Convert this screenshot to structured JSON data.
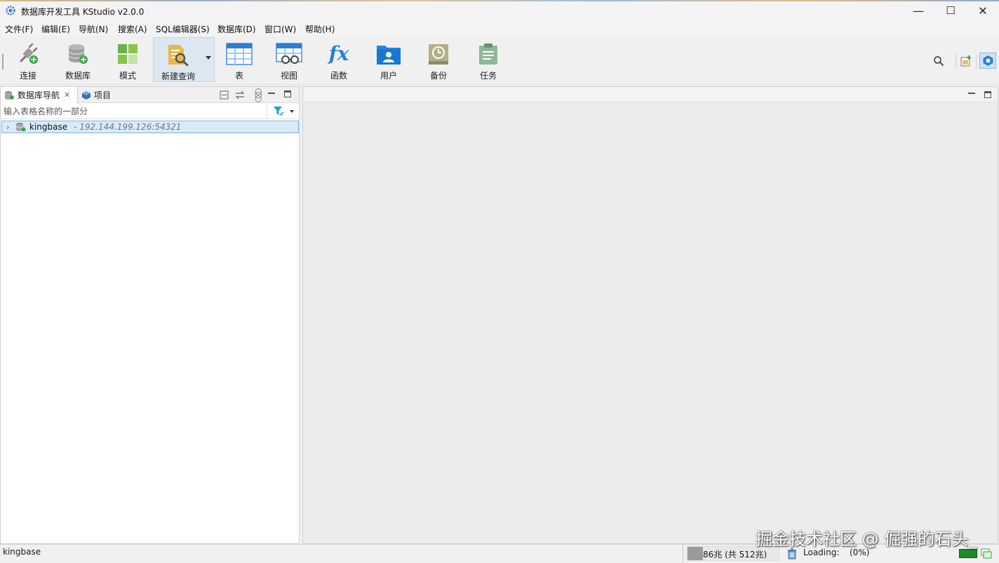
{
  "window": {
    "title": "数据库开发工具 KStudio v2.0.0",
    "minimize_glyph": "—",
    "maximize_glyph": "☐",
    "close_glyph": "✕"
  },
  "menu": [
    "文件(F)",
    "编辑(E)",
    "导航(N)",
    "搜索(A)",
    "SQL编辑器(S)",
    "数据库(D)",
    "窗口(W)",
    "帮助(H)"
  ],
  "toolbar": {
    "connect": "连接",
    "database": "数据库",
    "schema": "模式",
    "new_query": "新建查询",
    "table": "表",
    "view": "视图",
    "function": "函数",
    "function_glyph": "fx",
    "user": "用户",
    "backup": "备份",
    "task": "任务"
  },
  "navigator": {
    "tab_db_nav": "数据库导航",
    "tab_project": "项目",
    "filter_placeholder": "输入表格名称的一部分",
    "tree": [
      {
        "name": "kingbase",
        "detail": "- 192.144.199.126:54321"
      }
    ]
  },
  "status": {
    "selection": "kingbase",
    "memory": "86兆 (共 512兆)",
    "memory_fraction": 0.17,
    "loading": "Loading:",
    "loading_percent": "(0%)"
  },
  "watermark": "掘金技术社区 @ 倔强的石头_",
  "colors": {
    "accent_blue": "#2a7fd4",
    "selection_bg": "#d9eaf8",
    "green": "#3aa648"
  }
}
